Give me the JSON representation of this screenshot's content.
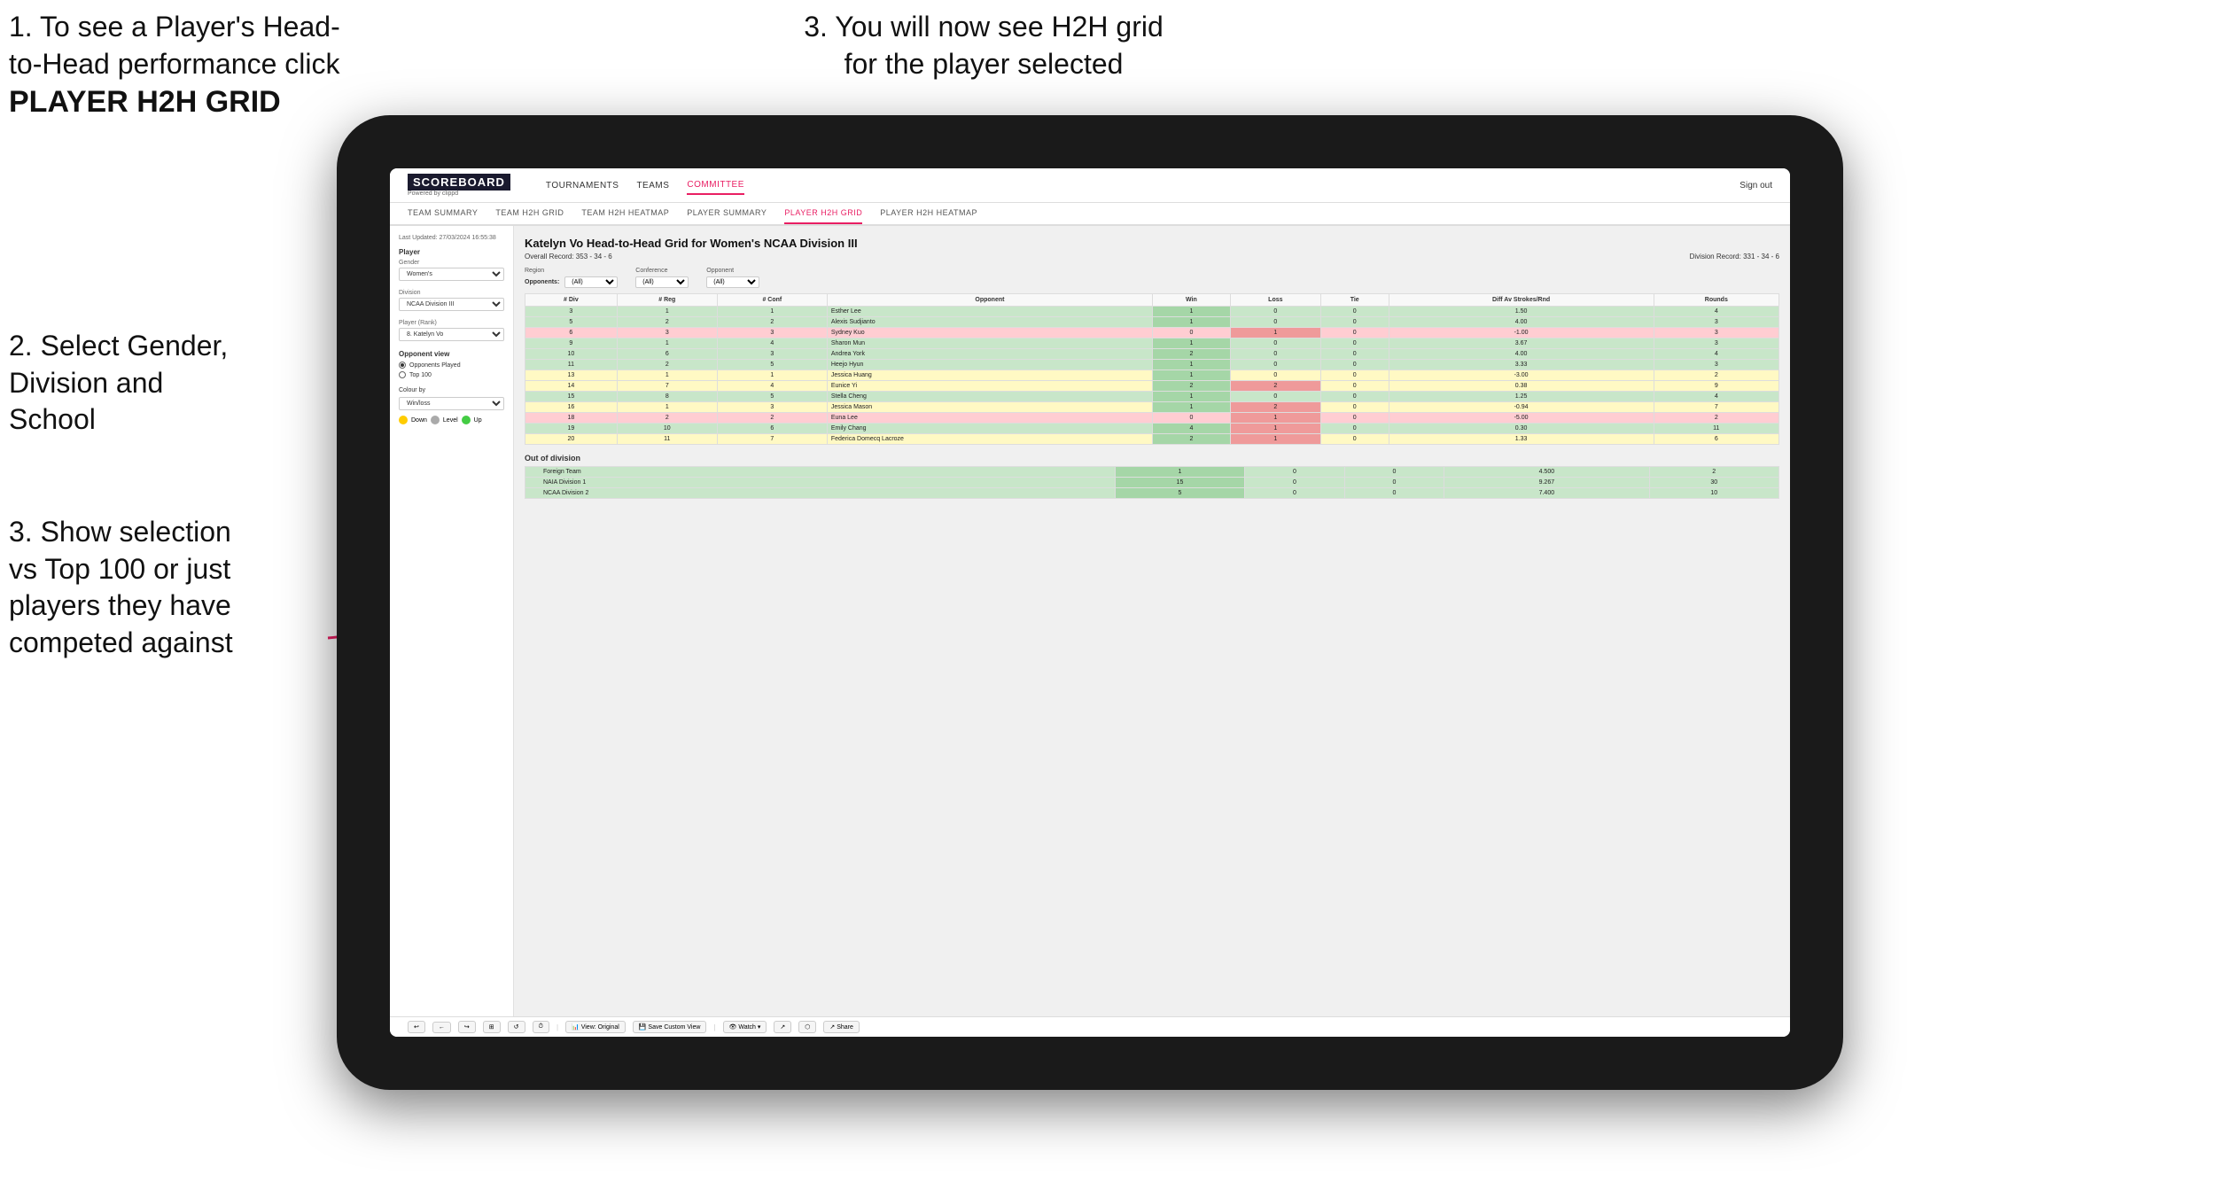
{
  "instructions": {
    "top_left_line1": "1. To see a Player's Head-",
    "top_left_line2": "to-Head performance click",
    "top_left_bold": "PLAYER H2H GRID",
    "top_right": "3. You will now see H2H grid\nfor the player selected",
    "mid_left_line1": "2. Select Gender,",
    "mid_left_line2": "Division and",
    "mid_left_line3": "School",
    "bottom_left_line1": "3. Show selection",
    "bottom_left_line2": "vs Top 100 or just",
    "bottom_left_line3": "players they have",
    "bottom_left_line4": "competed against"
  },
  "navbar": {
    "logo": "SCOREBOARD",
    "powered_by": "Powered by clippd",
    "links": [
      "TOURNAMENTS",
      "TEAMS",
      "COMMITTEE"
    ],
    "active_link": "COMMITTEE",
    "sign_out": "Sign out"
  },
  "subnav": {
    "links": [
      "TEAM SUMMARY",
      "TEAM H2H GRID",
      "TEAM H2H HEATMAP",
      "PLAYER SUMMARY",
      "PLAYER H2H GRID",
      "PLAYER H2H HEATMAP"
    ],
    "active": "PLAYER H2H GRID"
  },
  "sidebar": {
    "timestamp": "Last Updated: 27/03/2024\n16:55:38",
    "player_label": "Player",
    "gender_label": "Gender",
    "gender_value": "Women's",
    "division_label": "Division",
    "division_value": "NCAA Division III",
    "player_rank_label": "Player (Rank)",
    "player_rank_value": "8. Katelyn Vo",
    "opponent_view_label": "Opponent view",
    "opponent_options": [
      "Opponents Played",
      "Top 100"
    ],
    "selected_opponent": "Opponents Played",
    "colour_by_label": "Colour by",
    "colour_by_value": "Win/loss",
    "legend": {
      "down_label": "Down",
      "level_label": "Level",
      "up_label": "Up",
      "down_color": "#ffcc00",
      "level_color": "#aaaaaa",
      "up_color": "#44cc44"
    }
  },
  "grid": {
    "title": "Katelyn Vo Head-to-Head Grid for Women's NCAA Division III",
    "overall_record": "Overall Record: 353 - 34 - 6",
    "division_record": "Division Record: 331 - 34 - 6",
    "filters": {
      "region_label": "Region",
      "region_opponent_label": "Opponents:",
      "region_value": "(All)",
      "conference_label": "Conference",
      "conference_value": "(All)",
      "opponent_label": "Opponent",
      "opponent_value": "(All)"
    },
    "table_headers": [
      "# Div",
      "# Reg",
      "# Conf",
      "Opponent",
      "Win",
      "Loss",
      "Tie",
      "Diff Av Strokes/Rnd",
      "Rounds"
    ],
    "rows": [
      {
        "div": 3,
        "reg": 1,
        "conf": 1,
        "opponent": "Esther Lee",
        "win": 1,
        "loss": 0,
        "tie": 0,
        "diff": 1.5,
        "rounds": 4,
        "style": "win"
      },
      {
        "div": 5,
        "reg": 2,
        "conf": 2,
        "opponent": "Alexis Sudjianto",
        "win": 1,
        "loss": 0,
        "tie": 0,
        "diff": 4.0,
        "rounds": 3,
        "style": "win"
      },
      {
        "div": 6,
        "reg": 3,
        "conf": 3,
        "opponent": "Sydney Kuo",
        "win": 0,
        "loss": 1,
        "tie": 0,
        "diff": -1.0,
        "rounds": 3,
        "style": "loss"
      },
      {
        "div": 9,
        "reg": 1,
        "conf": 4,
        "opponent": "Sharon Mun",
        "win": 1,
        "loss": 0,
        "tie": 0,
        "diff": 3.67,
        "rounds": 3,
        "style": "win"
      },
      {
        "div": 10,
        "reg": 6,
        "conf": 3,
        "opponent": "Andrea York",
        "win": 2,
        "loss": 0,
        "tie": 0,
        "diff": 4.0,
        "rounds": 4,
        "style": "win"
      },
      {
        "div": 11,
        "reg": 2,
        "conf": 5,
        "opponent": "Heejo Hyun",
        "win": 1,
        "loss": 0,
        "tie": 0,
        "diff": 3.33,
        "rounds": 3,
        "style": "win"
      },
      {
        "div": 13,
        "reg": 1,
        "conf": 1,
        "opponent": "Jessica Huang",
        "win": 1,
        "loss": 0,
        "tie": 0,
        "diff": -3.0,
        "rounds": 2,
        "style": "mixed"
      },
      {
        "div": 14,
        "reg": 7,
        "conf": 4,
        "opponent": "Eunice Yi",
        "win": 2,
        "loss": 2,
        "tie": 0,
        "diff": 0.38,
        "rounds": 9,
        "style": "mixed"
      },
      {
        "div": 15,
        "reg": 8,
        "conf": 5,
        "opponent": "Stella Cheng",
        "win": 1,
        "loss": 0,
        "tie": 0,
        "diff": 1.25,
        "rounds": 4,
        "style": "win"
      },
      {
        "div": 16,
        "reg": 1,
        "conf": 3,
        "opponent": "Jessica Mason",
        "win": 1,
        "loss": 2,
        "tie": 0,
        "diff": -0.94,
        "rounds": 7,
        "style": "mixed"
      },
      {
        "div": 18,
        "reg": 2,
        "conf": 2,
        "opponent": "Euna Lee",
        "win": 0,
        "loss": 1,
        "tie": 0,
        "diff": -5.0,
        "rounds": 2,
        "style": "loss"
      },
      {
        "div": 19,
        "reg": 10,
        "conf": 6,
        "opponent": "Emily Chang",
        "win": 4,
        "loss": 1,
        "tie": 0,
        "diff": 0.3,
        "rounds": 11,
        "style": "win"
      },
      {
        "div": 20,
        "reg": 11,
        "conf": 7,
        "opponent": "Federica Domecq Lacroze",
        "win": 2,
        "loss": 1,
        "tie": 0,
        "diff": 1.33,
        "rounds": 6,
        "style": "mixed"
      }
    ],
    "out_of_division_title": "Out of division",
    "out_of_division_rows": [
      {
        "name": "Foreign Team",
        "win": 1,
        "loss": 0,
        "tie": 0,
        "diff": 4.5,
        "rounds": 2,
        "style": "win"
      },
      {
        "name": "NAIA Division 1",
        "win": 15,
        "loss": 0,
        "tie": 0,
        "diff": 9.267,
        "rounds": 30,
        "style": "win"
      },
      {
        "name": "NCAA Division 2",
        "win": 5,
        "loss": 0,
        "tie": 0,
        "diff": 7.4,
        "rounds": 10,
        "style": "win"
      }
    ]
  },
  "toolbar": {
    "buttons": [
      "↩",
      "←",
      "↪",
      "⊞",
      "↺",
      "⏱",
      "View: Original",
      "Save Custom View",
      "Watch ▾",
      "↗",
      "⬡",
      "Share"
    ]
  }
}
